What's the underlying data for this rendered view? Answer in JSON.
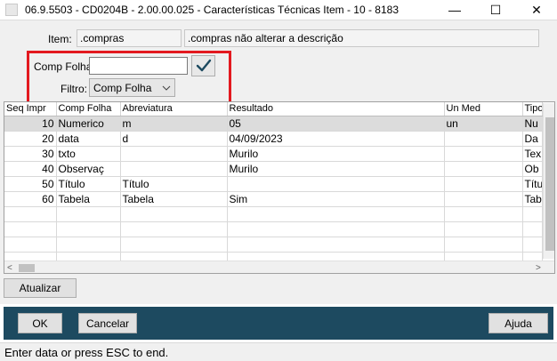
{
  "window": {
    "title": "06.9.5503 - CD0204B - 2.00.00.025 - Características Técnicas Item - 10 - 8183",
    "minimize_glyph": "—",
    "maximize_glyph": "☐",
    "close_glyph": "✕"
  },
  "item": {
    "label": "Item:",
    "code": ".compras",
    "description": ".compras não alterar a descrição"
  },
  "comp_folha": {
    "label": "Comp Folha:",
    "value": ""
  },
  "filtro": {
    "label": "Filtro:",
    "selected": "Comp Folha"
  },
  "grid": {
    "columns": [
      "Seq Impr",
      "Comp Folha",
      "Abreviatura",
      "Resultado",
      "Un Med",
      "Tipo"
    ],
    "rows": [
      {
        "seq": "10",
        "comp_folha": "Numerico",
        "abreviatura": "m",
        "resultado": "05",
        "un_med": "un",
        "tipo": "Nu"
      },
      {
        "seq": "20",
        "comp_folha": "data",
        "abreviatura": "d",
        "resultado": "04/09/2023",
        "un_med": "",
        "tipo": "Da"
      },
      {
        "seq": "30",
        "comp_folha": "txto",
        "abreviatura": "",
        "resultado": "Murilo",
        "un_med": "",
        "tipo": "Tex"
      },
      {
        "seq": "40",
        "comp_folha": "Observaç",
        "abreviatura": "",
        "resultado": "Murilo",
        "un_med": "",
        "tipo": "Ob"
      },
      {
        "seq": "50",
        "comp_folha": "Título",
        "abreviatura": "Título",
        "resultado": "",
        "un_med": "",
        "tipo": "Títu"
      },
      {
        "seq": "60",
        "comp_folha": "Tabela",
        "abreviatura": "Tabela",
        "resultado": "Sim",
        "un_med": "",
        "tipo": "Tab"
      }
    ],
    "scroll_left_glyph": "<",
    "scroll_right_glyph": ">"
  },
  "buttons": {
    "refresh": "Atualizar",
    "ok": "OK",
    "cancel": "Cancelar",
    "help": "Ajuda"
  },
  "status": {
    "text": "Enter data or press ESC to end."
  },
  "colors": {
    "footer": "#1d4a60",
    "highlight": "#e3191f",
    "confirm_check": "#1d4a60"
  }
}
